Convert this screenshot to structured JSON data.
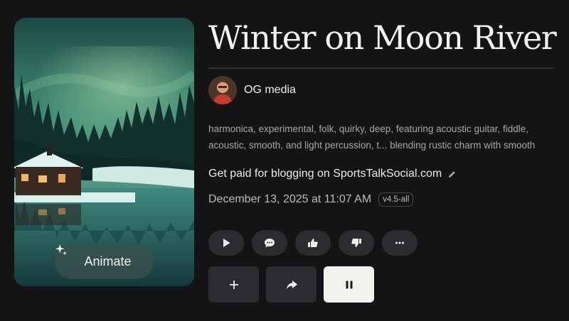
{
  "song": {
    "title": "Winter on Moon River",
    "author": "OG media",
    "tags_line1": "harmonica, experimental, folk, quirky, deep, featuring acoustic guitar, fiddle,",
    "tags_line2": "acoustic, smooth, and light percussion, t... blending rustic charm with smooth",
    "promo_text": "Get paid for blogging on SportsTalkSocial.com",
    "date": "December 13, 2025 at 11:07 AM",
    "model_version": "v4.5-all"
  },
  "artwork": {
    "animate_label": "Animate"
  },
  "actions": {
    "pills": [
      {
        "name": "play-button",
        "icon": "play-icon"
      },
      {
        "name": "comment-button",
        "icon": "comment-icon"
      },
      {
        "name": "like-button",
        "icon": "thumbs-up-icon"
      },
      {
        "name": "dislike-button",
        "icon": "thumbs-down-icon"
      },
      {
        "name": "more-button",
        "icon": "more-icon"
      }
    ],
    "squares": [
      {
        "name": "add-button",
        "icon": "plus-icon"
      },
      {
        "name": "share-button",
        "icon": "share-icon"
      },
      {
        "name": "pause-button",
        "icon": "pause-icon",
        "active": true
      }
    ]
  },
  "colors": {
    "background": "#141416",
    "button_bg": "#2c2c30",
    "active_button_bg": "#f3f1ec",
    "title_text": "#f4f2ee",
    "muted_text": "#a9a7a3"
  }
}
